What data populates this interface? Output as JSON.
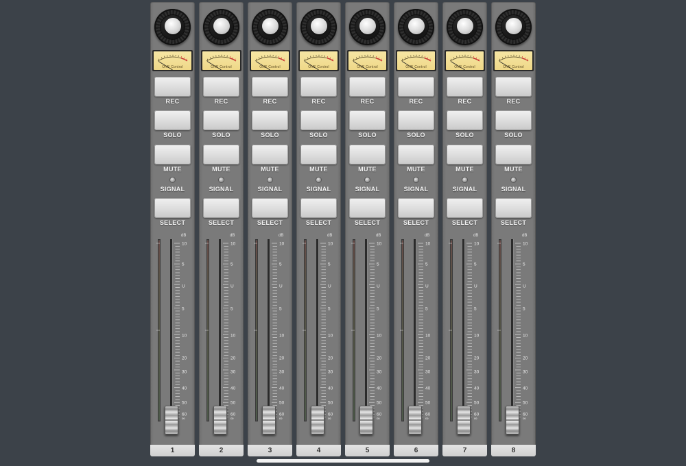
{
  "mixer": {
    "vu_brand": "ONE Control",
    "db_unit": "dB",
    "scale_labels": [
      "10",
      "5",
      "U",
      "5",
      "10",
      "20",
      "30",
      "40",
      "50",
      "60",
      "∞"
    ],
    "channels": [
      {
        "number": "1",
        "rec": "REC",
        "solo": "SOLO",
        "mute": "MUTE",
        "signal": "SIGNAL",
        "select": "SELECT"
      },
      {
        "number": "2",
        "rec": "REC",
        "solo": "SOLO",
        "mute": "MUTE",
        "signal": "SIGNAL",
        "select": "SELECT"
      },
      {
        "number": "3",
        "rec": "REC",
        "solo": "SOLO",
        "mute": "MUTE",
        "signal": "SIGNAL",
        "select": "SELECT"
      },
      {
        "number": "4",
        "rec": "REC",
        "solo": "SOLO",
        "mute": "MUTE",
        "signal": "SIGNAL",
        "select": "SELECT"
      },
      {
        "number": "5",
        "rec": "REC",
        "solo": "SOLO",
        "mute": "MUTE",
        "signal": "SIGNAL",
        "select": "SELECT"
      },
      {
        "number": "6",
        "rec": "REC",
        "solo": "SOLO",
        "mute": "MUTE",
        "signal": "SIGNAL",
        "select": "SELECT"
      },
      {
        "number": "7",
        "rec": "REC",
        "solo": "SOLO",
        "mute": "MUTE",
        "signal": "SIGNAL",
        "select": "SELECT"
      },
      {
        "number": "8",
        "rec": "REC",
        "solo": "SOLO",
        "mute": "MUTE",
        "signal": "SIGNAL",
        "select": "SELECT"
      }
    ]
  },
  "colors": {
    "background": "#3c4249",
    "strip": "#7a7a7a",
    "vu_face": "#f6e6a4"
  }
}
